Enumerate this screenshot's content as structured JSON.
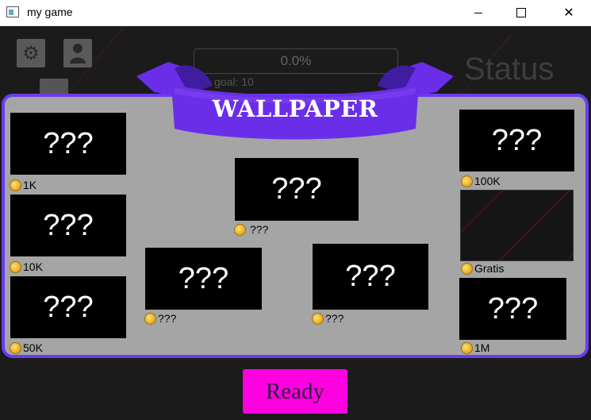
{
  "window": {
    "title": "my game"
  },
  "hud": {
    "progress": "0.0%",
    "goal": "goal: 10",
    "status": "Status"
  },
  "banner": {
    "title": "WALLPAPER"
  },
  "items": [
    {
      "label": "???",
      "price": "1K"
    },
    {
      "label": "???",
      "price": "10K"
    },
    {
      "label": "???",
      "price": "50K"
    },
    {
      "label": "???",
      "price": "???"
    },
    {
      "label": "???",
      "price": "???"
    },
    {
      "label": "???",
      "price": "???"
    },
    {
      "label": "???",
      "price": "100K"
    },
    {
      "label": "",
      "price": "Gratis"
    },
    {
      "label": "???",
      "price": "1M"
    }
  ],
  "footer": {
    "ready": "Ready"
  },
  "colors": {
    "panel_border": "#6a3cf0",
    "ready_button": "#ff00e1",
    "panel_bg": "#a5a5a5"
  }
}
